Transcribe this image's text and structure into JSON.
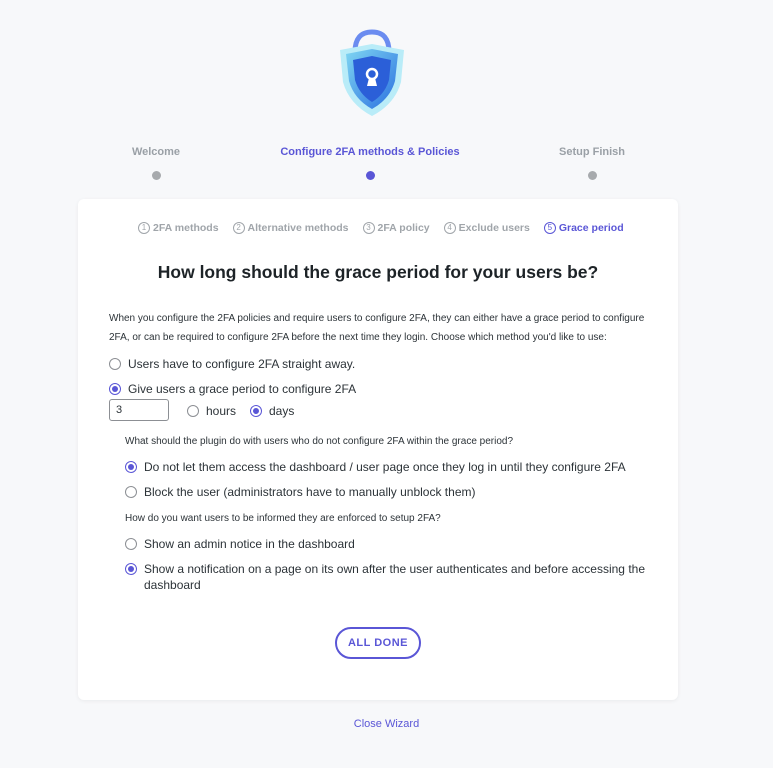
{
  "logo": {
    "icon": "shield-lock-icon"
  },
  "steps": [
    {
      "label": "Welcome",
      "active": false
    },
    {
      "label": "Configure 2FA methods & Policies",
      "active": true
    },
    {
      "label": "Setup Finish",
      "active": false
    }
  ],
  "substeps": [
    {
      "num": "1",
      "label": "2FA methods"
    },
    {
      "num": "2",
      "label": "Alternative methods"
    },
    {
      "num": "3",
      "label": "2FA policy"
    },
    {
      "num": "4",
      "label": "Exclude users"
    },
    {
      "num": "5",
      "label": "Grace period"
    }
  ],
  "title": "How long should the grace period for your users be?",
  "intro": "When you configure the 2FA policies and require users to configure 2FA, they can either have a grace period to configure 2FA, or can be required to configure 2FA before the next time they login. Choose which method you'd like to use:",
  "grace": {
    "option_now": "Users have to configure 2FA straight away.",
    "option_grace": "Give users a grace period to configure 2FA",
    "value": "3",
    "unit_hours": "hours",
    "unit_days": "days"
  },
  "after_grace": {
    "question": "What should the plugin do with users who do not configure 2FA within the grace period?",
    "option_block_dashboard": "Do not let them access the dashboard / user page once they log in until they configure 2FA",
    "option_block_user": "Block the user (administrators have to manually unblock them)"
  },
  "notify": {
    "question": "How do you want users to be informed they are enforced to setup 2FA?",
    "option_admin_notice": "Show an admin notice in the dashboard",
    "option_page_line1": "Show a notification on a page on its own after the user authenticates and before accessing the",
    "option_page_line2": "dashboard"
  },
  "done_label": "ALL DONE",
  "close_label": "Close Wizard",
  "colors": {
    "accent": "#5a56d6",
    "inactive": "#a7aaad"
  }
}
